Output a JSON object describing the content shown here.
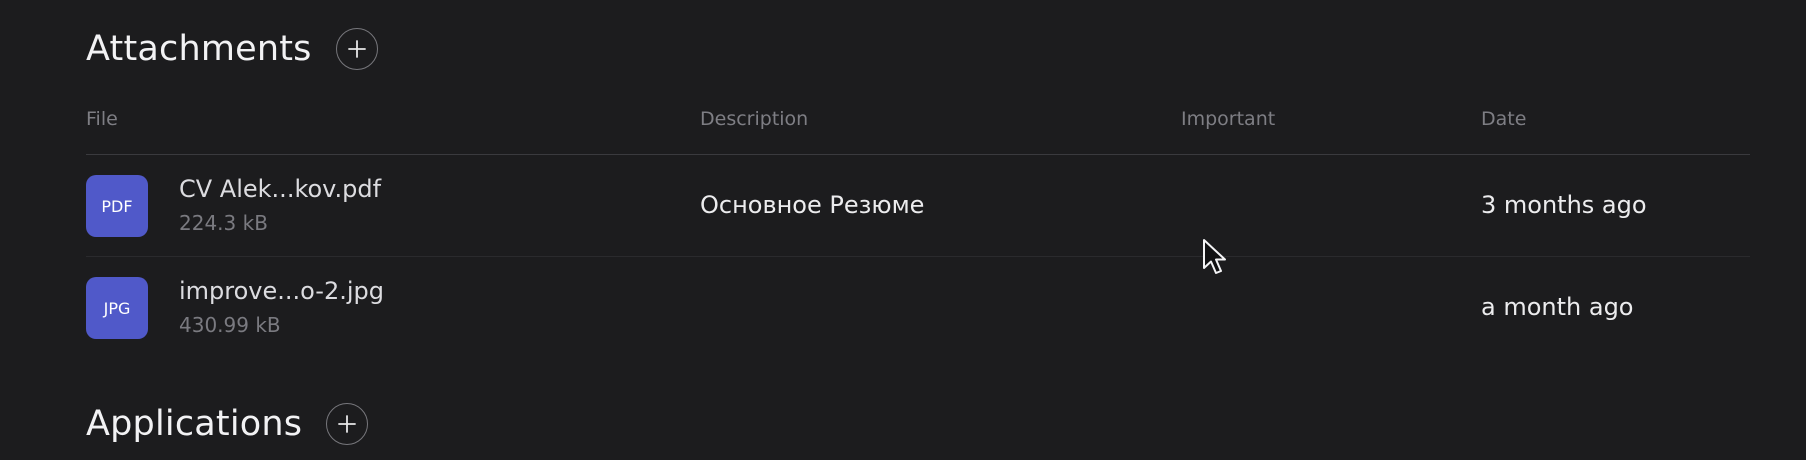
{
  "attachments": {
    "title": "Attachments",
    "columns": {
      "file": "File",
      "description": "Description",
      "important": "Important",
      "date": "Date"
    },
    "rows": [
      {
        "type": "PDF",
        "name": "CV Alek...kov.pdf",
        "size": "224.3 kB",
        "description": "Основное Резюме",
        "date": "3 months ago"
      },
      {
        "type": "JPG",
        "name": "improve...o-2.jpg",
        "size": "430.99 kB",
        "description": "",
        "date": "a month ago"
      }
    ]
  },
  "applications": {
    "title": "Applications"
  },
  "colors": {
    "background": "#1c1c1e",
    "file_badge": "#5059c9"
  },
  "icons": {
    "add": "plus-icon",
    "cursor": "mouse-pointer-icon"
  }
}
